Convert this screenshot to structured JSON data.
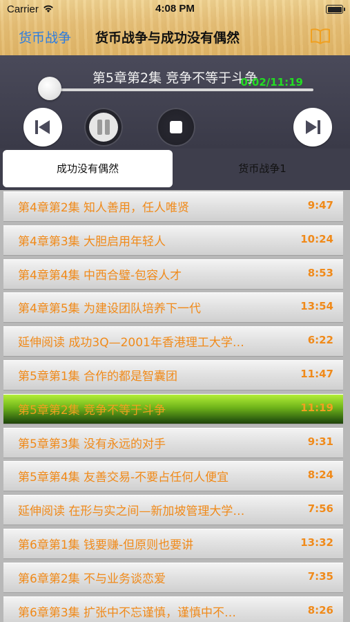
{
  "status_bar": {
    "carrier": "Carrier",
    "time": "4:08 PM"
  },
  "nav": {
    "back_label": "货币战争",
    "title": "货币战争与成功没有偶然",
    "right_icon": "book-icon"
  },
  "player": {
    "track_title": "第5章第2集 竞争不等于斗争",
    "time_readout": "0:02/11:19",
    "progress": 0.003,
    "controls": [
      "previous",
      "pause",
      "stop",
      "next"
    ]
  },
  "tabs": [
    {
      "label": "成功没有偶然",
      "selected": true
    },
    {
      "label": "货币战争1",
      "selected": false
    }
  ],
  "episodes": [
    {
      "title": "第4章第2集 知人善用，任人唯贤",
      "duration": "9:47"
    },
    {
      "title": "第4章第3集 大胆启用年轻人",
      "duration": "10:24"
    },
    {
      "title": "第4章第4集 中西合璧-包容人才",
      "duration": "8:53"
    },
    {
      "title": "第4章第5集 为建设团队培养下一代",
      "duration": "13:54"
    },
    {
      "title": "延伸阅读 成功3Q—2001年香港理工大学…",
      "duration": "6:22"
    },
    {
      "title": "第5章第1集 合作的都是智囊团",
      "duration": "11:47"
    },
    {
      "title": "第5章第2集 竞争不等于斗争",
      "duration": "11:19",
      "playing": true
    },
    {
      "title": "第5章第3集 没有永远的对手",
      "duration": "9:31"
    },
    {
      "title": "第5章第4集 友善交易-不要占任何人便宜",
      "duration": "8:24"
    },
    {
      "title": "延伸阅读 在形与实之间—新加坡管理大学…",
      "duration": "7:56"
    },
    {
      "title": "第6章第1集 钱要赚-但原则也要讲",
      "duration": "13:32"
    },
    {
      "title": "第6章第2集 不与业务谈恋爱",
      "duration": "7:35"
    },
    {
      "title": "第6章第3集 扩张中不忘谨慎，谨慎中不…",
      "duration": "8:26"
    }
  ],
  "colors": {
    "accent_blue": "#2d7de0",
    "list_text": "#f08a1a",
    "time_green": "#22dd22",
    "playing_row": "#6fb41a"
  }
}
